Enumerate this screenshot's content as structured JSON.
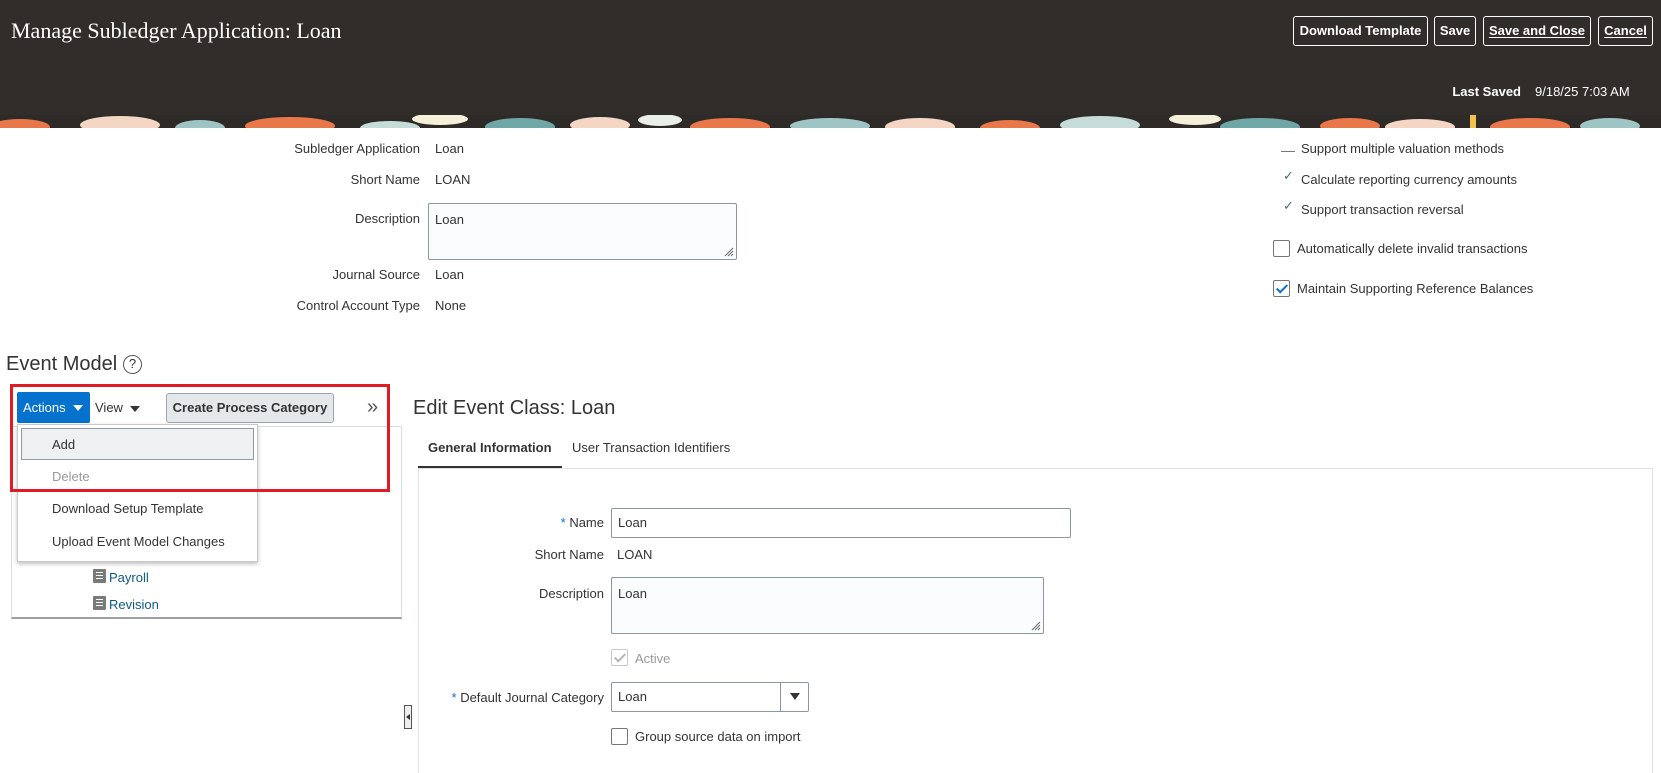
{
  "header": {
    "title": "Manage Subledger Application: Loan",
    "buttons": {
      "download_template": "Download Template",
      "save": "Save",
      "save_and_close": "Save and Close",
      "cancel": "Cancel"
    },
    "last_saved_label": "Last Saved",
    "last_saved_value": "9/18/25 7:03 AM"
  },
  "application": {
    "subledger_application_label": "Subledger Application",
    "subledger_application_value": "Loan",
    "short_name_label": "Short Name",
    "short_name_value": "LOAN",
    "description_label": "Description",
    "description_value": "Loan",
    "journal_source_label": "Journal Source",
    "journal_source_value": "Loan",
    "control_account_type_label": "Control Account Type",
    "control_account_type_value": "None"
  },
  "options": {
    "support_multiple_valuation": "Support multiple valuation methods",
    "calculate_reporting_currency": "Calculate reporting currency amounts",
    "support_transaction_reversal": "Support transaction reversal",
    "auto_delete_invalid": "Automatically delete invalid transactions",
    "maintain_supporting_ref": "Maintain Supporting Reference Balances"
  },
  "event_model": {
    "title": "Event Model",
    "help_glyph": "?",
    "toolbar": {
      "actions": "Actions",
      "view": "View",
      "create_process_category": "Create Process Category",
      "expand_glyph": "»"
    },
    "actions_menu": [
      "Add",
      "Delete",
      "Download Setup Template",
      "Upload Event Model Changes"
    ],
    "tree_nodes": [
      "Payroll",
      "Revision"
    ]
  },
  "edit_event_class": {
    "title": "Edit Event Class: Loan",
    "tabs": [
      "General Information",
      "User Transaction Identifiers"
    ],
    "name_label": "Name",
    "name_value": "Loan",
    "short_name_label": "Short Name",
    "short_name_value": "LOAN",
    "description_label": "Description",
    "description_value": "Loan",
    "active_label": "Active",
    "default_journal_category_label": "Default Journal Category",
    "default_journal_category_value": "Loan",
    "group_source_label": "Group source data on import",
    "required_marker": "*"
  },
  "colors": {
    "header_bg": "#312d2a",
    "accent": "#0572ce",
    "highlight": "#e01b24",
    "link": "#0b5a86"
  }
}
